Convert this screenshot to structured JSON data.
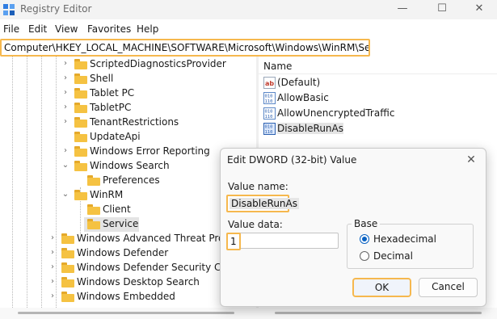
{
  "window": {
    "title": "Registry Editor",
    "controls": {
      "minimize": "—",
      "maximize": "☐",
      "close": "✕"
    },
    "highlight_color": "#f6b84e"
  },
  "menu": [
    "File",
    "Edit",
    "View",
    "Favorites",
    "Help"
  ],
  "address": "Computer\\HKEY_LOCAL_MACHINE\\SOFTWARE\\Microsoft\\Windows\\WinRM\\Service",
  "tree": [
    {
      "label": "ScriptedDiagnosticsProvider",
      "expanded": false
    },
    {
      "label": "Shell",
      "expanded": false
    },
    {
      "label": "Tablet PC",
      "expanded": false
    },
    {
      "label": "TabletPC",
      "expanded": false
    },
    {
      "label": "TenantRestrictions",
      "expanded": false
    },
    {
      "label": "UpdateApi",
      "expanded": null
    },
    {
      "label": "Windows Error Reporting",
      "expanded": false
    },
    {
      "label": "Windows Search",
      "expanded": true
    },
    {
      "label": "Preferences",
      "expanded": null
    },
    {
      "label": "WinRM",
      "expanded": true
    },
    {
      "label": "Client",
      "expanded": null
    },
    {
      "label": "Service",
      "expanded": null,
      "selected": true
    },
    {
      "label": "Windows Advanced Threat Protec",
      "expanded": false
    },
    {
      "label": "Windows Defender",
      "expanded": false
    },
    {
      "label": "Windows Defender Security Cente",
      "expanded": false
    },
    {
      "label": "Windows Desktop Search",
      "expanded": false
    },
    {
      "label": "Windows Embedded",
      "expanded": false
    }
  ],
  "values_pane": {
    "column_name": "Name",
    "rows": [
      {
        "name": "(Default)",
        "icon": "string-value-icon"
      },
      {
        "name": "AllowBasic",
        "icon": "dword-value-icon"
      },
      {
        "name": "AllowUnencryptedTraffic",
        "icon": "dword-value-icon"
      },
      {
        "name": "DisableRunAs",
        "icon": "dword-value-icon",
        "selected": true
      }
    ]
  },
  "dialog": {
    "title": "Edit DWORD (32-bit) Value",
    "close": "✕",
    "value_name_label": "Value name:",
    "value_name": "DisableRunAs",
    "value_data_label": "Value data:",
    "value_data": "1",
    "base_label": "Base",
    "options": [
      {
        "label": "Hexadecimal",
        "selected": true
      },
      {
        "label": "Decimal",
        "selected": false
      }
    ],
    "ok": "OK",
    "cancel": "Cancel"
  }
}
